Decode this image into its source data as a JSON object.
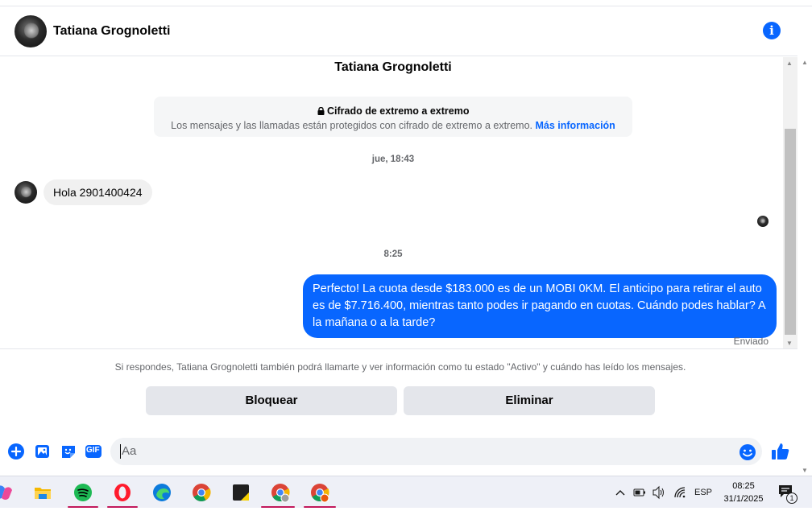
{
  "header": {
    "contact_name": "Tatiana Grognoletti"
  },
  "thread": {
    "title": "Tatiana Grognoletti",
    "encryption": {
      "title": "Cifrado de extremo a extremo",
      "text": "Los mensajes y las llamadas están protegidos con cifrado de extremo a extremo.",
      "link": "Más información"
    },
    "messages": [
      {
        "timestamp": "jue, 18:43",
        "direction": "in",
        "text": "Hola  2901400424"
      },
      {
        "timestamp": "8:25",
        "direction": "out",
        "text": "Perfecto! La cuota desde $183.000 es de un MOBI 0KM. El anticipo para retirar el auto es de $7.716.400, mientras tanto podes ir pagando en cuotas. Cuándo podes hablar? A la mañana o a la tarde?"
      }
    ],
    "status": "Enviado"
  },
  "request_footer": {
    "notice": "Si respondes, Tatiana Grognoletti también podrá llamarte y ver información como tu estado \"Activo\" y cuándo has leído los mensajes.",
    "block_label": "Bloquear",
    "delete_label": "Eliminar"
  },
  "composer": {
    "placeholder": "Aa",
    "gif_label": "GIF"
  },
  "colors": {
    "accent": "#0866ff",
    "bubble_in": "#f0f0f0"
  },
  "taskbar": {
    "apps": [
      "copilot-icon",
      "file-explorer-icon",
      "spotify-icon",
      "opera-icon",
      "edge-icon",
      "chrome-icon",
      "sticky-notes-icon",
      "chrome-profile-icon",
      "chrome-profile-2-icon"
    ],
    "language": "ESP",
    "time": "08:25",
    "date": "31/1/2025",
    "notifications": "1"
  }
}
